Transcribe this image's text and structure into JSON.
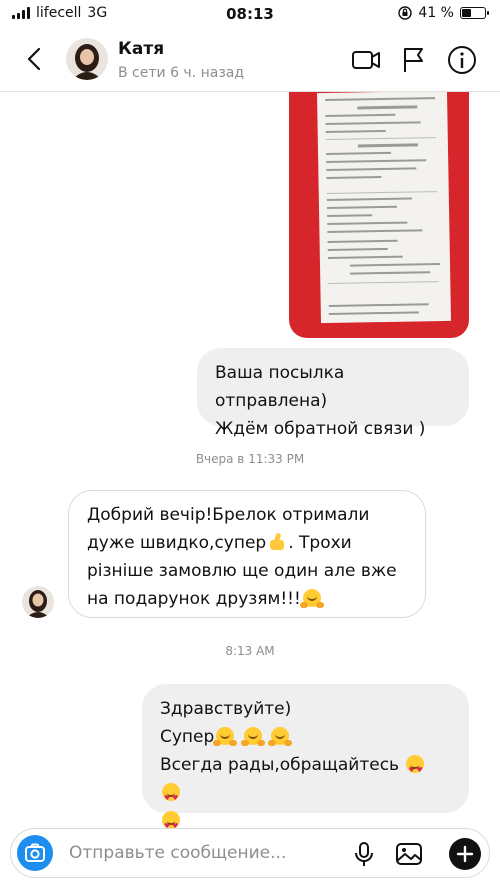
{
  "status_bar": {
    "carrier": "lifecell",
    "network": "3G",
    "time": "08:13",
    "battery": "41 %",
    "battery_level": 0.41
  },
  "header": {
    "contact_name": "Катя",
    "contact_status": "В сети 6 ч. назад"
  },
  "messages": {
    "outgoing_1": "Ваша посылка отправлена)\nЖдём обратной связи )",
    "timestamp_1": "Вчера в 11:33 PM",
    "incoming_1_part1": "Добрий вечір!Брелок отримали\nдуже швидко,супер",
    "incoming_1_part2": ". Трохи\npізніше замовлю ще один але вже\nна подарунок друзям!!!",
    "timestamp_2": "8:13 AM",
    "outgoing_2_line1": "Здравствуйте)",
    "outgoing_2_line2": "Супер",
    "outgoing_2_line3": "Всегда рады,обращайтесь"
  },
  "composer": {
    "placeholder": "Отправьте сообщение..."
  },
  "colors": {
    "accent": "#1d8df0",
    "bubble_out": "#efefef",
    "receipt_bg": "#d7262b"
  }
}
